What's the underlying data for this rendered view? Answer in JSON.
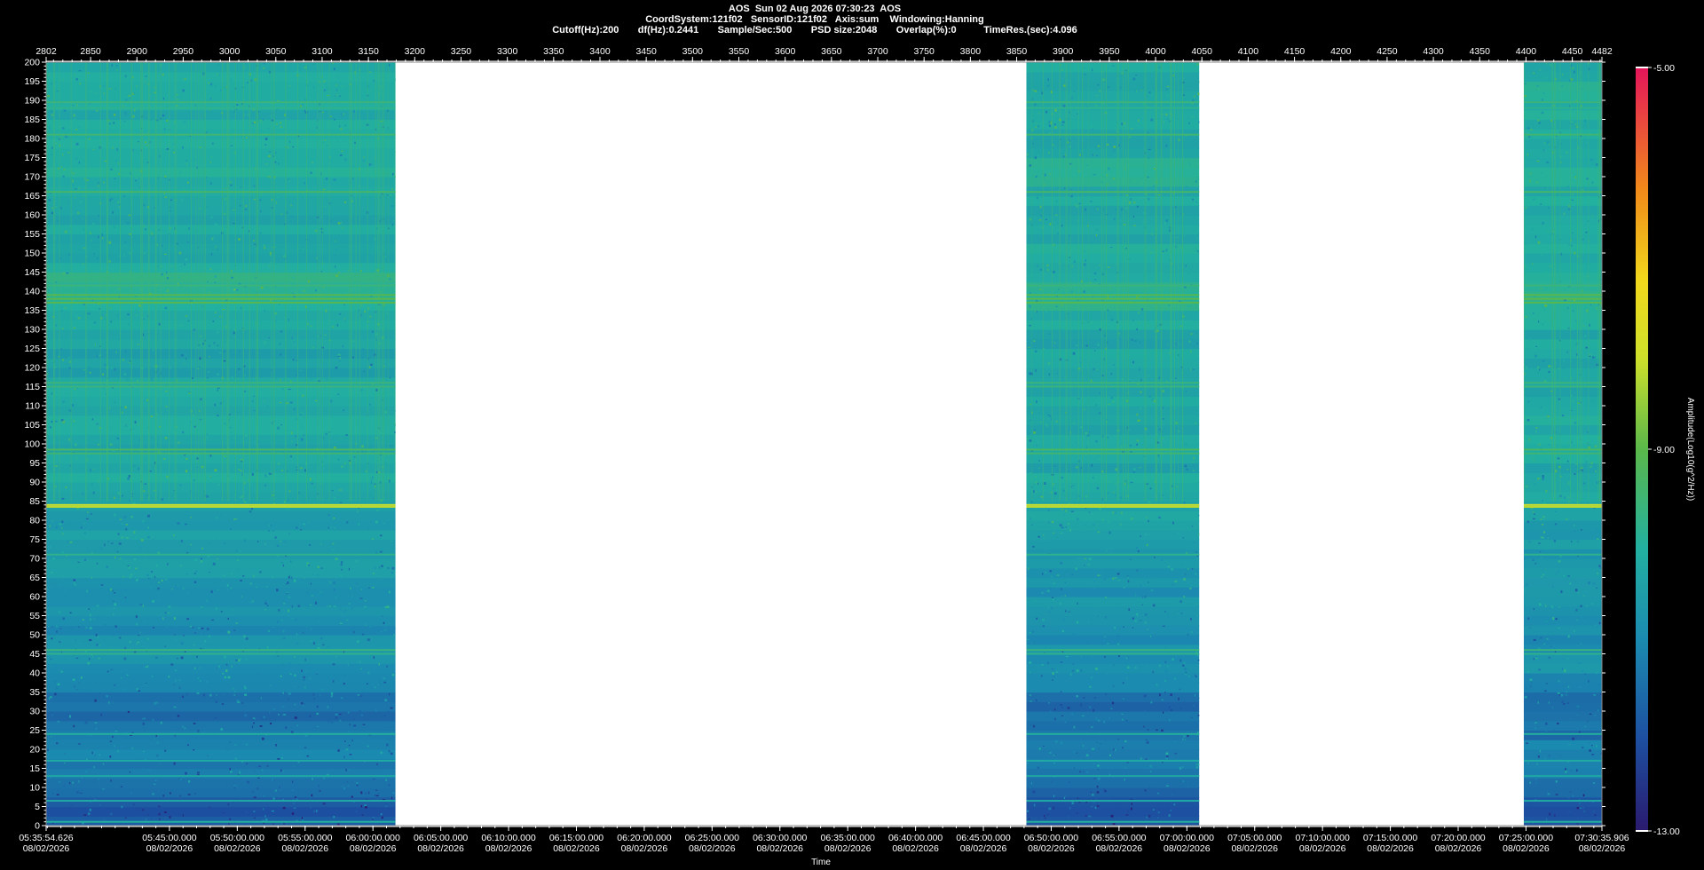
{
  "header": {
    "line1": "AOS  Sun 02 Aug 2026 07:30:23  AOS",
    "line2": "CoordSystem:121f02   SensorID:121f02   Axis:sum    Windowing:Hanning",
    "line3": "Cutoff(Hz):200       df(Hz):0.2441       Sample/Sec:500       PSD size:2048       Overlap(%):0          TimeRes.(sec):4.096"
  },
  "chart_data": {
    "type": "heatmap",
    "title": "AOS  Sun 02 Aug 2026 07:30:23  AOS",
    "xlabel": "Time",
    "ylabel": "",
    "colorbar_label": "Amplitude(Log10(g^2/Hz))",
    "colorbar_ticks": [
      "-5.00",
      "-9.00",
      "-13.00"
    ],
    "clim": [
      -13,
      -5
    ],
    "ylim": [
      0,
      200
    ],
    "y_ticks": [
      200,
      195,
      190,
      185,
      180,
      175,
      170,
      165,
      160,
      155,
      150,
      145,
      140,
      135,
      130,
      125,
      120,
      115,
      110,
      105,
      100,
      95,
      90,
      85,
      80,
      75,
      70,
      65,
      60,
      55,
      50,
      45,
      40,
      35,
      30,
      25,
      20,
      15,
      10,
      5,
      0
    ],
    "top_axis_range": [
      2802,
      4482
    ],
    "top_ticks": [
      "2802",
      "2850",
      "2900",
      "2950",
      "3000",
      "3050",
      "3100",
      "3150",
      "3200",
      "3250",
      "3300",
      "3350",
      "3400",
      "3450",
      "3500",
      "3550",
      "3600",
      "3650",
      "3700",
      "3750",
      "3800",
      "3850",
      "3900",
      "3950",
      "4000",
      "4050",
      "4100",
      "4150",
      "4200",
      "4250",
      "4300",
      "4350",
      "4400",
      "4450",
      "4482"
    ],
    "time_ticks": [
      {
        "time": "05:35:54.626",
        "date": "08/02/2026"
      },
      {
        "time": "05:45:00.000",
        "date": "08/02/2026"
      },
      {
        "time": "05:50:00.000",
        "date": "08/02/2026"
      },
      {
        "time": "05:55:00.000",
        "date": "08/02/2026"
      },
      {
        "time": "06:00:00.000",
        "date": "08/02/2026"
      },
      {
        "time": "06:05:00.000",
        "date": "08/02/2026"
      },
      {
        "time": "06:10:00.000",
        "date": "08/02/2026"
      },
      {
        "time": "06:15:00.000",
        "date": "08/02/2026"
      },
      {
        "time": "06:20:00.000",
        "date": "08/02/2026"
      },
      {
        "time": "06:25:00.000",
        "date": "08/02/2026"
      },
      {
        "time": "06:30:00.000",
        "date": "08/02/2026"
      },
      {
        "time": "06:35:00.000",
        "date": "08/02/2026"
      },
      {
        "time": "06:40:00.000",
        "date": "08/02/2026"
      },
      {
        "time": "06:45:00.000",
        "date": "08/02/2026"
      },
      {
        "time": "06:50:00.000",
        "date": "08/02/2026"
      },
      {
        "time": "06:55:00.000",
        "date": "08/02/2026"
      },
      {
        "time": "07:00:00.000",
        "date": "08/02/2026"
      },
      {
        "time": "07:05:00.000",
        "date": "08/02/2026"
      },
      {
        "time": "07:10:00.000",
        "date": "08/02/2026"
      },
      {
        "time": "07:15:00.000",
        "date": "08/02/2026"
      },
      {
        "time": "07:20:00.000",
        "date": "08/02/2026"
      },
      {
        "time": "07:25:00.000",
        "date": "08/02/2026"
      },
      {
        "time": "07:30:35.906",
        "date": "08/02/2026"
      }
    ],
    "data_segments": [
      {
        "start": "05:35:54.626",
        "end": "06:01:40"
      },
      {
        "start": "06:48:10",
        "end": "07:00:55"
      },
      {
        "start": "07:24:50",
        "end": "07:30:35.906"
      }
    ],
    "spectral_lines": [
      {
        "hz": 189.5,
        "level": -9.6
      },
      {
        "hz": 188,
        "level": -9.8
      },
      {
        "hz": 181,
        "level": -9.5
      },
      {
        "hz": 166,
        "level": -9.4
      },
      {
        "hz": 141.5,
        "level": -9.6
      },
      {
        "hz": 139,
        "level": -9.1
      },
      {
        "hz": 138,
        "level": -9.0
      },
      {
        "hz": 137,
        "level": -9.1
      },
      {
        "hz": 116,
        "level": -9.6
      },
      {
        "hz": 115,
        "level": -9.6
      },
      {
        "hz": 98.5,
        "level": -9.3
      },
      {
        "hz": 97.5,
        "level": -9.5
      },
      {
        "hz": 84,
        "level": -8.0
      },
      {
        "hz": 83.5,
        "level": -8.2
      },
      {
        "hz": 71,
        "level": -9.8
      },
      {
        "hz": 46,
        "level": -9.6
      },
      {
        "hz": 45,
        "level": -9.8
      },
      {
        "hz": 24,
        "level": -10.0
      },
      {
        "hz": 17,
        "level": -10.2
      },
      {
        "hz": 13,
        "level": -10.3
      },
      {
        "hz": 6.5,
        "level": -10.2
      },
      {
        "hz": 1,
        "level": -10.0
      }
    ],
    "background_profile": [
      {
        "hz": 0,
        "level": -11.8
      },
      {
        "hz": 5,
        "level": -12.0
      },
      {
        "hz": 10,
        "level": -11.6
      },
      {
        "hz": 15,
        "level": -11.2
      },
      {
        "hz": 20,
        "level": -11.2
      },
      {
        "hz": 30,
        "level": -11.6
      },
      {
        "hz": 35,
        "level": -11.2
      },
      {
        "hz": 40,
        "level": -10.8
      },
      {
        "hz": 50,
        "level": -10.9
      },
      {
        "hz": 60,
        "level": -10.8
      },
      {
        "hz": 70,
        "level": -10.6
      },
      {
        "hz": 80,
        "level": -10.5
      },
      {
        "hz": 85,
        "level": -10.3
      },
      {
        "hz": 90,
        "level": -10.3
      },
      {
        "hz": 100,
        "level": -10.3
      },
      {
        "hz": 110,
        "level": -10.2
      },
      {
        "hz": 120,
        "level": -10.4
      },
      {
        "hz": 130,
        "level": -10.3
      },
      {
        "hz": 140,
        "level": -9.8
      },
      {
        "hz": 150,
        "level": -10.2
      },
      {
        "hz": 160,
        "level": -10.2
      },
      {
        "hz": 170,
        "level": -10.1
      },
      {
        "hz": 180,
        "level": -10.2
      },
      {
        "hz": 190,
        "level": -10.1
      },
      {
        "hz": 200,
        "level": -10.2
      }
    ]
  }
}
